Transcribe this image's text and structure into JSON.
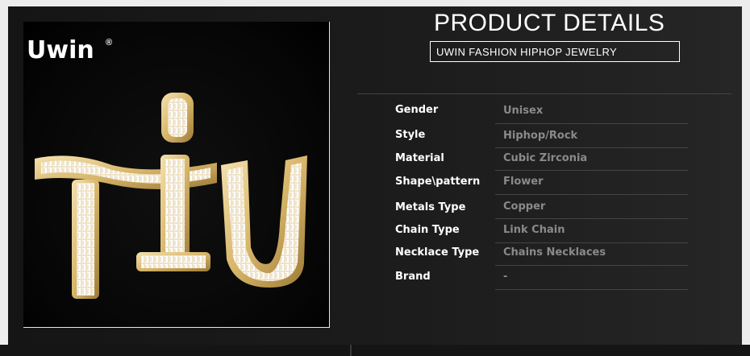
{
  "brand": {
    "logo_text": "Uwin",
    "trademark": "®"
  },
  "header": {
    "title": "PRODUCT DETAILS",
    "subtitle": "UWIN FASHION HIPHOP JEWELRY"
  },
  "specs": [
    {
      "label": "Gender",
      "value": "Unisex"
    },
    {
      "label": "Style",
      "value": "Hiphop/Rock"
    },
    {
      "label": "Material",
      "value": "Cubic Zirconia"
    },
    {
      "label": "Shape\\pattern",
      "value": "Flower"
    },
    {
      "label": "Metals Type",
      "value": "Copper"
    },
    {
      "label": "Chain Type",
      "value": "Link Chain"
    },
    {
      "label": "Necklace Type",
      "value": "Chains Necklaces"
    },
    {
      "label": "Brand",
      "value": "-"
    }
  ],
  "product_image": {
    "depicts": "gold-pendant-letters",
    "letters": "TIU"
  },
  "colors": {
    "background": "#1a1a1a",
    "text_primary": "#ffffff",
    "text_secondary": "#8a8a8a",
    "gold": "#d8b66a"
  }
}
